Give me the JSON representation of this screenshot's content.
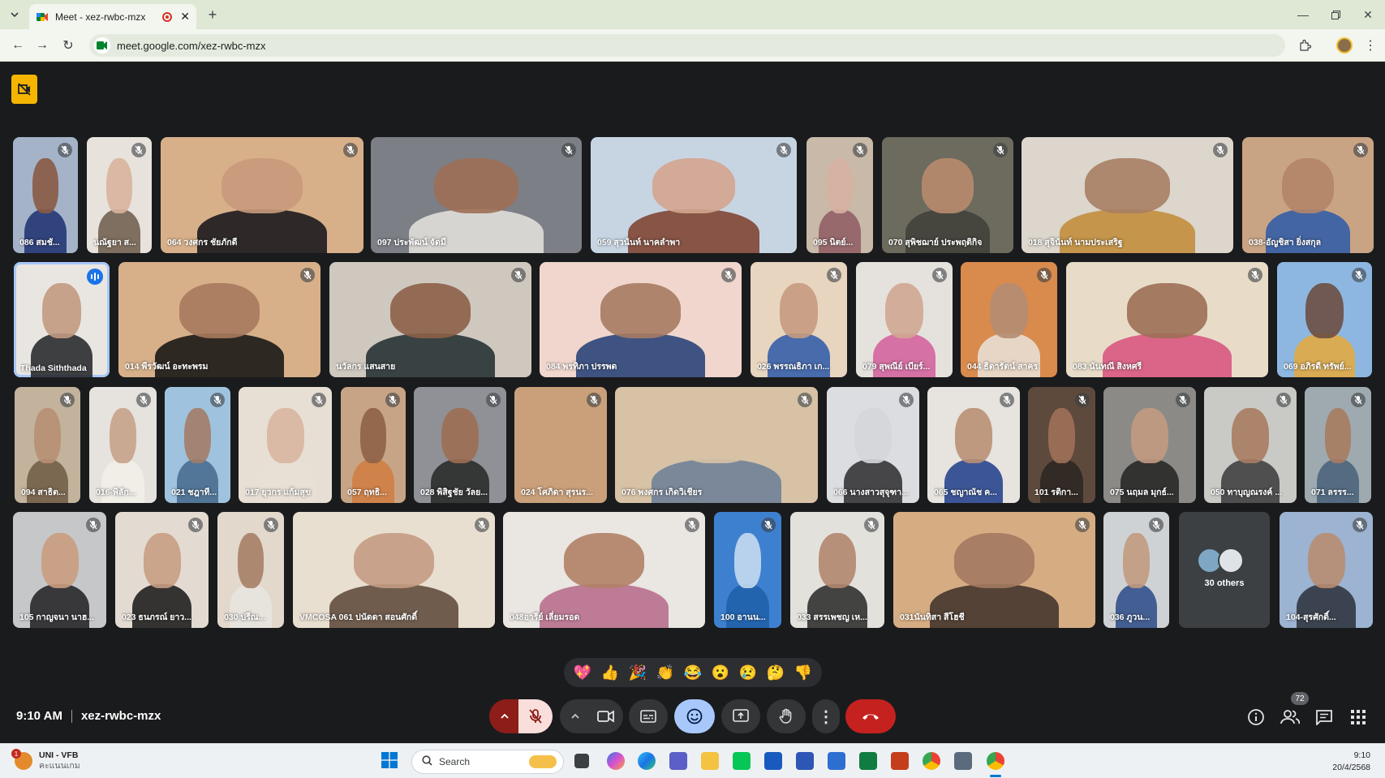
{
  "browser": {
    "tab_title": "Meet - xez-rwbc-mzx",
    "url": "meet.google.com/xez-rwbc-mzx"
  },
  "participants": [
    {
      "name": "086 สมชั...",
      "bg": "#a4b3c8",
      "face": "#8a5a44",
      "shirt": "#1d2f6f"
    },
    {
      "name": "นณัฐยา ส...",
      "bg": "#e7e2dc",
      "face": "#d8b49c",
      "shirt": "#6b5a4a"
    },
    {
      "name": "064 วงศกร ชัยภักดี",
      "bg": "#d7b08a",
      "face": "#c99a7b",
      "shirt": "#101216"
    },
    {
      "name": "097 ประพัฒน์ จัดมี",
      "bg": "#7c7f86",
      "face": "#9d6f55",
      "shirt": "#e7e4df"
    },
    {
      "name": "059 สุวนันท์ นาคลำพา",
      "bg": "#c7d5e3",
      "face": "#d4a58e",
      "shirt": "#7b3d2a"
    },
    {
      "name": "095 นิตย์...",
      "bg": "#c8b9a8",
      "face": "#d7b1a2",
      "shirt": "#8f5a62"
    },
    {
      "name": "070 สุพิชฌาย์ ประพฤติกิจ",
      "bg": "#6d6a5e",
      "face": "#b88b6e",
      "shirt": "#40403a"
    },
    {
      "name": "018 สุจินันท์ นามประเสริฐ",
      "bg": "#dcd6cc",
      "face": "#a77e64",
      "shirt": "#c08a34"
    },
    {
      "name": "038-อัญชิสา ยิ่งสกุล",
      "bg": "#c9a484",
      "face": "#b48568",
      "shirt": "#2b5aa8"
    },
    {
      "name": "Thada Siththada",
      "bg": "#e9e6e1",
      "face": "#c29a82",
      "shirt": "#202124"
    },
    {
      "name": "014 พีรวัฒน์ อะทะพรม",
      "bg": "#d7b08a",
      "face": "#a97a5d",
      "shirt": "#111"
    },
    {
      "name": "นวัลกร แสนสาย",
      "bg": "#cfc8bf",
      "face": "#8c6148",
      "shirt": "#1f2a2d"
    },
    {
      "name": "084 พรทิภา ปรรพด",
      "bg": "#f0d6cc",
      "face": "#a77b63",
      "shirt": "#1f3c73"
    },
    {
      "name": "026 พรรณธิภา เก...",
      "bg": "#e7d5bf",
      "face": "#c79b80",
      "shirt": "#2b58a8"
    },
    {
      "name": "079 สุพณีย์ เบียร์...",
      "bg": "#e5e2dd",
      "face": "#cfa792",
      "shirt": "#d45d9b"
    },
    {
      "name": "044 ธิดารัตน์ สาคร",
      "bg": "#d98a4d",
      "face": "#b48c72",
      "shirt": "#e9e3dc"
    },
    {
      "name": "083 นันทณี สิงหศรี",
      "bg": "#e8dcc9",
      "face": "#9c6f55",
      "shirt": "#d7507c"
    },
    {
      "name": "069 อภิรดี ทรัพย์...",
      "bg": "#8db7e0",
      "face": "#6b4f42",
      "shirt": "#e6a93a"
    },
    {
      "name": "094 สาธิต...",
      "bg": "#c3b39d",
      "face": "#b88f74",
      "shirt": "#6e5b44"
    },
    {
      "name": "016-พิลัก...",
      "bg": "#e6e3de",
      "face": "#c7a28a",
      "shirt": "#f2eee9"
    },
    {
      "name": "021 ชฎาที...",
      "bg": "#9fc3de",
      "face": "#a37d68",
      "shirt": "#43688c"
    },
    {
      "name": "017 ยุวกร แก้มสุข",
      "bg": "#e7dfd4",
      "face": "#d8b5a0",
      "shirt": "#e9e1d5"
    },
    {
      "name": "057 ฤทธิ...",
      "bg": "#c8a486",
      "face": "#8e6247",
      "shirt": "#d07e3f"
    },
    {
      "name": "028 พิสิฐชัย วัลย...",
      "bg": "#8f9196",
      "face": "#9c6f52",
      "shirt": "#262626"
    },
    {
      "name": "024 โศภิดา สุรนร...",
      "bg": "#caa07a",
      "face": "#caa07a",
      "shirt": "#caa07a"
    },
    {
      "name": "076 พงศกร เกิดวิเชียร",
      "bg": "#d7c2a6",
      "face": "#d7c2a6",
      "shirt": "#6a7e97"
    },
    {
      "name": "066 นางสาวสุจุฑา...",
      "bg": "#dcdde0",
      "face": "#d5d6d9",
      "shirt": "#2c2c2e"
    },
    {
      "name": "065 ชญาณัช ค...",
      "bg": "#e7e3de",
      "face": "#b98f74",
      "shirt": "#1d3c8a"
    },
    {
      "name": "101 รติกา...",
      "bg": "#5e4a3d",
      "face": "#9e7058",
      "shirt": "#2a2421"
    },
    {
      "name": "075 นฤมล มุกธ์...",
      "bg": "#8c8a86",
      "face": "#c29a82",
      "shirt": "#222"
    },
    {
      "name": "050 ทาบุญณรงค์ ...",
      "bg": "#c9cac6",
      "face": "#a87c61",
      "shirt": "#3a3a3a"
    },
    {
      "name": "071 ลรรร...",
      "bg": "#9eaab0",
      "face": "#a77b61",
      "shirt": "#47607a"
    },
    {
      "name": "105 กาญจนา นาฮ...",
      "bg": "#c5c7c9",
      "face": "#c99c80",
      "shirt": "#1f1f22"
    },
    {
      "name": "023 ธนภรณ์ ยาว...",
      "bg": "#e3dbd1",
      "face": "#c69d83",
      "shirt": "#151515"
    },
    {
      "name": "030 ปรีณ...",
      "bg": "#e2d8cb",
      "face": "#a77f66",
      "shirt": "#e8e5e1"
    },
    {
      "name": "VMCOSA 061 ปนัดดา สอนศักดิ์",
      "bg": "#e9dfd0",
      "face": "#c49b83",
      "shirt": "#5a4536"
    },
    {
      "name": "048อารีย์ เลี่ยมรอด",
      "bg": "#eae6e1",
      "face": "#b08166",
      "shirt": "#b66788"
    },
    {
      "name": "100 อานน...",
      "bg": "#3e80d0",
      "face": "#c5d9ee",
      "shirt": "#1f5fa8"
    },
    {
      "name": "033 สรรเพชญ เห...",
      "bg": "#e3e1dc",
      "face": "#b1876f",
      "shirt": "#272727"
    },
    {
      "name": "031นันทิสา สีโฮชี",
      "bg": "#d6ad83",
      "face": "#a37a60",
      "shirt": "#3c2f28"
    },
    {
      "name": "036 ภูวน...",
      "bg": "#cfd2d5",
      "face": "#c19a7f",
      "shirt": "#2a4a86"
    },
    {
      "name": "104-สุรศักดิ์...",
      "bg": "#9cb3d1",
      "face": "#b88d71",
      "shirt": "#2b2f3a"
    }
  ],
  "others": {
    "label": "30 others"
  },
  "reactions": [
    "💖",
    "👍",
    "🎉",
    "👏",
    "😂",
    "😮",
    "😢",
    "🤔",
    "👎"
  ],
  "meeting": {
    "time": "9:10 AM",
    "code": "xez-rwbc-mzx"
  },
  "people_count": "72",
  "taskbar": {
    "weather_title": "UNI - VFB",
    "weather_sub": "คะแนนเกม",
    "weather_badge": "1",
    "search_placeholder": "Search",
    "clock_time": "9:10",
    "clock_date": "20/4/2568"
  },
  "colors": {
    "stage_bg": "#1a1b1d",
    "end_call": "#c5221f",
    "active_blue": "#a8c7fa",
    "host_badge": "#f4b400"
  }
}
